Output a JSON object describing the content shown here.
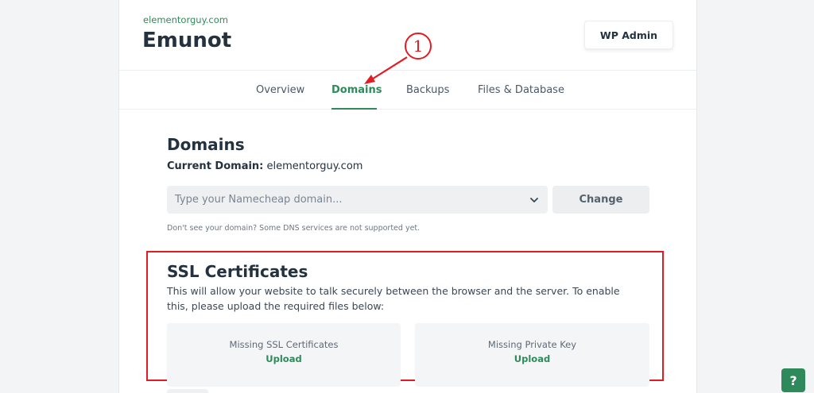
{
  "site": {
    "url": "elementorguy.com",
    "title": "Emunot"
  },
  "header": {
    "wp_admin_label": "WP Admin"
  },
  "tabs": [
    {
      "label": "Overview",
      "active": false
    },
    {
      "label": "Domains",
      "active": true
    },
    {
      "label": "Backups",
      "active": false
    },
    {
      "label": "Files & Database",
      "active": false
    }
  ],
  "annotation": {
    "number": "1",
    "color": "#e31b23"
  },
  "domains": {
    "title": "Domains",
    "current_label": "Current Domain:",
    "current_value": "elementorguy.com",
    "select_placeholder": "Type your Namecheap domain...",
    "change_label": "Change",
    "note": "Don't see your domain? Some DNS services are not supported yet."
  },
  "ssl": {
    "title": "SSL Certificates",
    "description": "This will allow your website to talk securely between the browser and the server. To enable this, please upload the required files below:",
    "cards": [
      {
        "label": "Missing SSL Certificates",
        "action": "Upload"
      },
      {
        "label": "Missing Private Key",
        "action": "Upload"
      }
    ]
  },
  "help": {
    "label": "?"
  },
  "colors": {
    "accent": "#2f8a5b",
    "highlight": "#e31b23"
  }
}
